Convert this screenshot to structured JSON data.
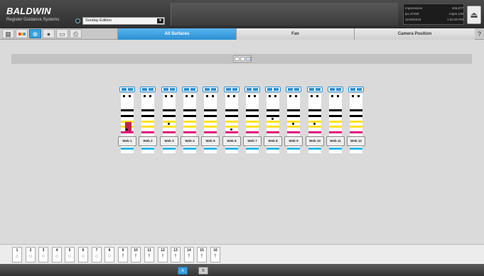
{
  "header": {
    "brand": "BALDWIN",
    "subtitle": "Register Guidance Systems",
    "edition": "Sunday Edition",
    "stats": [
      {
        "label": "Impressions",
        "value": "346,877"
      },
      {
        "label": "ips 37400",
        "value": "imprs 100"
      },
      {
        "label": "11/28/2019",
        "value": "1:34:20 PM"
      }
    ]
  },
  "toolbar": {
    "tabs": [
      {
        "label": "All Surfaces",
        "active": true
      },
      {
        "label": "Fan",
        "active": false
      },
      {
        "label": "Camera Position",
        "active": false
      }
    ],
    "help": "?"
  },
  "webs": [
    {
      "label": "Web 1"
    },
    {
      "label": "Web 2"
    },
    {
      "label": "Web 3"
    },
    {
      "label": "Web 4"
    },
    {
      "label": "Web 5"
    },
    {
      "label": "Web 6"
    },
    {
      "label": "Web 7"
    },
    {
      "label": "Web 8"
    },
    {
      "label": "Web 9"
    },
    {
      "label": "Web 10"
    },
    {
      "label": "Web 11"
    },
    {
      "label": "Web 12"
    }
  ],
  "units": [
    {
      "num": "1",
      "glyph": "○"
    },
    {
      "num": "2",
      "glyph": "○"
    },
    {
      "num": "3",
      "glyph": "○"
    },
    {
      "num": "4",
      "glyph": "○"
    },
    {
      "num": "5",
      "glyph": "○"
    },
    {
      "num": "6",
      "glyph": "○"
    },
    {
      "num": "7",
      "glyph": "○"
    },
    {
      "num": "8",
      "glyph": "○"
    },
    {
      "num": "9",
      "glyph": "†"
    },
    {
      "num": "10",
      "glyph": "†"
    },
    {
      "num": "11",
      "glyph": "†"
    },
    {
      "num": "12",
      "glyph": "†"
    },
    {
      "num": "13",
      "glyph": "†"
    },
    {
      "num": "14",
      "glyph": "†"
    },
    {
      "num": "15",
      "glyph": "†"
    },
    {
      "num": "16",
      "glyph": "†"
    }
  ],
  "pages": [
    {
      "label": "A",
      "active": true
    },
    {
      "label": "B",
      "active": false
    }
  ]
}
